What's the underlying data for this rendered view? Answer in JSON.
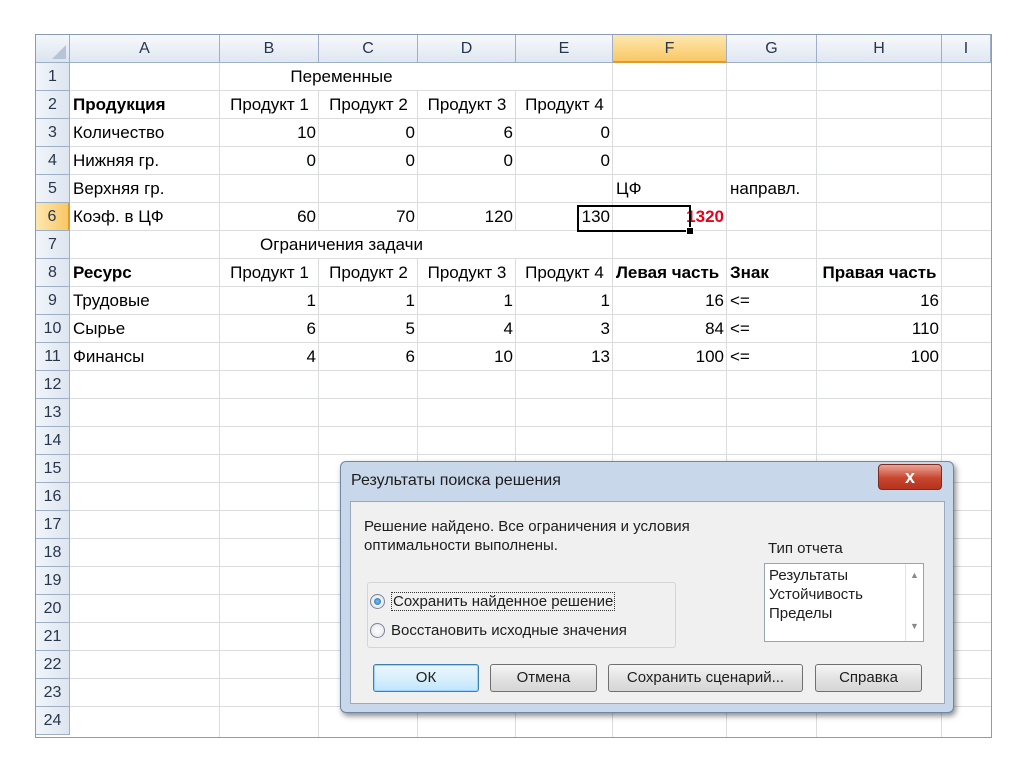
{
  "columns": [
    "A",
    "B",
    "C",
    "D",
    "E",
    "F",
    "G",
    "H",
    "I"
  ],
  "rows": [
    "1",
    "2",
    "3",
    "4",
    "5",
    "6",
    "7",
    "8",
    "9",
    "10",
    "11",
    "12",
    "13",
    "14",
    "15",
    "16",
    "17",
    "18",
    "19",
    "20",
    "21",
    "22",
    "23",
    "24"
  ],
  "selected_column": "F",
  "selected_row": "6",
  "cells": {
    "r1": {
      "title": "Переменные"
    },
    "r2": {
      "a": "Продукция",
      "b": "Продукт 1",
      "c": "Продукт 2",
      "d": "Продукт 3",
      "e": "Продукт 4"
    },
    "r3": {
      "a": "Количество",
      "b": "10",
      "c": "0",
      "d": "6",
      "e": "0"
    },
    "r4": {
      "a": "Нижняя гр.",
      "b": "0",
      "c": "0",
      "d": "0",
      "e": "0"
    },
    "r5": {
      "a": "Верхняя гр.",
      "f": "ЦФ",
      "g": "направл."
    },
    "r6": {
      "a": "Коэф. в ЦФ",
      "b": "60",
      "c": "70",
      "d": "120",
      "e": "130",
      "f": "1320"
    },
    "r7": {
      "title": "Ограничения задачи"
    },
    "r8": {
      "a": "Ресурс",
      "b": "Продукт 1",
      "c": "Продукт 2",
      "d": "Продукт 3",
      "e": "Продукт 4",
      "f": "Левая часть",
      "g": "Знак",
      "h": "Правая часть"
    },
    "r9": {
      "a": "Трудовые",
      "b": "1",
      "c": "1",
      "d": "1",
      "e": "1",
      "f": "16",
      "g": "<=",
      "h": "16"
    },
    "r10": {
      "a": "Сырье",
      "b": "6",
      "c": "5",
      "d": "4",
      "e": "3",
      "f": "84",
      "g": "<=",
      "h": "110"
    },
    "r11": {
      "a": "Финансы",
      "b": "4",
      "c": "6",
      "d": "10",
      "e": "13",
      "f": "100",
      "g": "<=",
      "h": "100"
    }
  },
  "dialog": {
    "title": "Результаты поиска решения",
    "close_glyph": "x",
    "message_line1": "Решение найдено. Все ограничения и условия",
    "message_line2": "оптимальности выполнены.",
    "report_type_label": "Тип отчета",
    "report_types": [
      "Результаты",
      "Устойчивость",
      "Пределы"
    ],
    "option_keep": "Сохранить найденное решение",
    "option_restore": "Восстановить исходные значения",
    "selected_option": "keep",
    "buttons": {
      "ok": "ОК",
      "cancel": "Отмена",
      "save_scenario": "Сохранить сценарий...",
      "help": "Справка"
    }
  }
}
